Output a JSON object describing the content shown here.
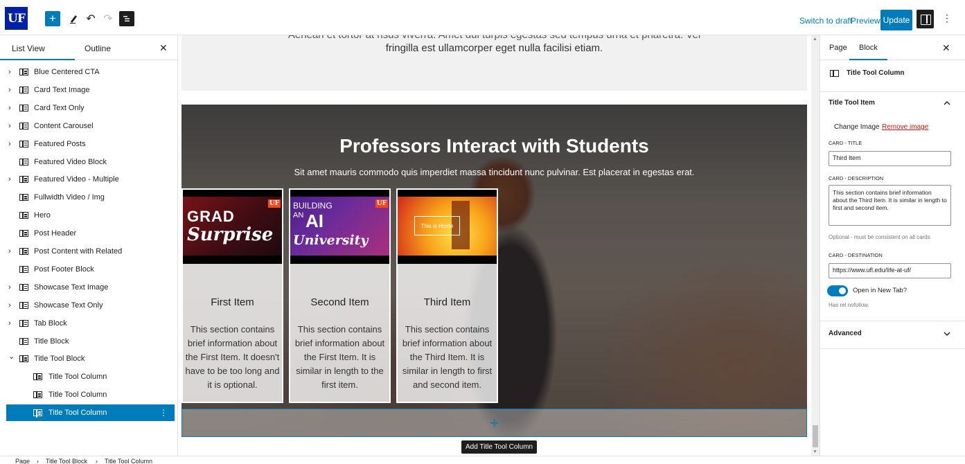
{
  "header": {
    "logo": "UF",
    "add_icon": "+",
    "edit_icon": "pencil-icon",
    "undo_icon": "↶",
    "redo_icon": "↷",
    "switch_draft": "Switch to draft",
    "preview": "Preview",
    "update": "Update",
    "more_icon": "⋮"
  },
  "left_panel": {
    "tab_list": "List View",
    "tab_outline": "Outline",
    "close_icon": "✕",
    "items": [
      {
        "label": "Blue Centered CTA",
        "expandable": true
      },
      {
        "label": "Card Text Image",
        "expandable": true
      },
      {
        "label": "Card Text Only",
        "expandable": true
      },
      {
        "label": "Content Carousel",
        "expandable": true
      },
      {
        "label": "Featured Posts",
        "expandable": true
      },
      {
        "label": "Featured Video Block",
        "expandable": false
      },
      {
        "label": "Featured Video - Multiple",
        "expandable": true
      },
      {
        "label": "Fullwidth Video / Img",
        "expandable": false
      },
      {
        "label": "Hero",
        "expandable": false
      },
      {
        "label": "Post Header",
        "expandable": false
      },
      {
        "label": "Post Content with Related",
        "expandable": true
      },
      {
        "label": "Post Footer Block",
        "expandable": false
      },
      {
        "label": "Showcase Text Image",
        "expandable": true
      },
      {
        "label": "Showcase Text Only",
        "expandable": true
      },
      {
        "label": "Tab Block",
        "expandable": true
      },
      {
        "label": "Title Block",
        "expandable": false
      },
      {
        "label": "Title Tool Block",
        "expandable": true,
        "expanded": true
      },
      {
        "label": "Title Tool Column",
        "child": true
      },
      {
        "label": "Title Tool Column",
        "child": true
      },
      {
        "label": "Title Tool Column",
        "child": true,
        "selected": true
      }
    ]
  },
  "canvas": {
    "intro_line1": "Aenean et tortor at risus viverra. Amet dui turpis egestas sed tempus urna et pharetra. Vel",
    "intro_line2": "fringilla est ullamcorper eget nulla facilisi etiam.",
    "hero_title": "Professors Interact with Students",
    "hero_subtitle": "Sit amet mauris commodo quis imperdiet massa tincidunt nunc pulvinar. Est placerat in egestas erat.",
    "cards": [
      {
        "title": "First Item",
        "desc": "This section contains brief information about the First Item. It doesn't have to be too long and it is optional.",
        "img_text_1": "GRAD",
        "img_text_2": "Surprise"
      },
      {
        "title": "Second Item",
        "desc": "This section contains brief information about the First Item. It is similar in length to the first item.",
        "img_text_1": "BUILDING",
        "img_text_2": "AI",
        "img_text_3": "University",
        "img_text_4": "AN"
      },
      {
        "title": "Third Item",
        "desc": "This section contains brief information about the Third Item. It is similar in length to first and second item.",
        "img_text_1": "This is Home"
      }
    ],
    "uf_tag": "UF",
    "add_column_icon": "+",
    "tooltip": "Add Title Tool Column"
  },
  "right_panel": {
    "tab_page": "Page",
    "tab_block": "Block",
    "close_icon": "✕",
    "block_name": "Title Tool Column",
    "section_title": "Title Tool Item",
    "change_image": "Change Image",
    "remove_image": "Remove image",
    "card_title_label": "CARD - TITLE",
    "card_title_value": "Third Item",
    "card_desc_label": "CARD - DESCRIPTION",
    "card_desc_value": "This section contains brief information about the Third Item. It is similar in length to first and second item.",
    "optional_help": "Optional - must be consistent on all cards",
    "card_dest_label": "CARD - DESTINATION",
    "card_dest_value": "https://www.ufl.edu/life-at-uf/",
    "open_new_tab": "Open in New Tab?",
    "open_new_tab_on": true,
    "rel_help": "Has rel nofollow.",
    "advanced": "Advanced",
    "chev_up": "⌃",
    "chev_down": "⌄"
  },
  "footer": {
    "crumb1": "Page",
    "crumb2": "Title Tool Block",
    "crumb3": "Title Tool Column",
    "sep": "›"
  },
  "colors": {
    "accent": "#007cba",
    "uf_blue": "#0021a5",
    "uf_orange": "#fa4616"
  }
}
